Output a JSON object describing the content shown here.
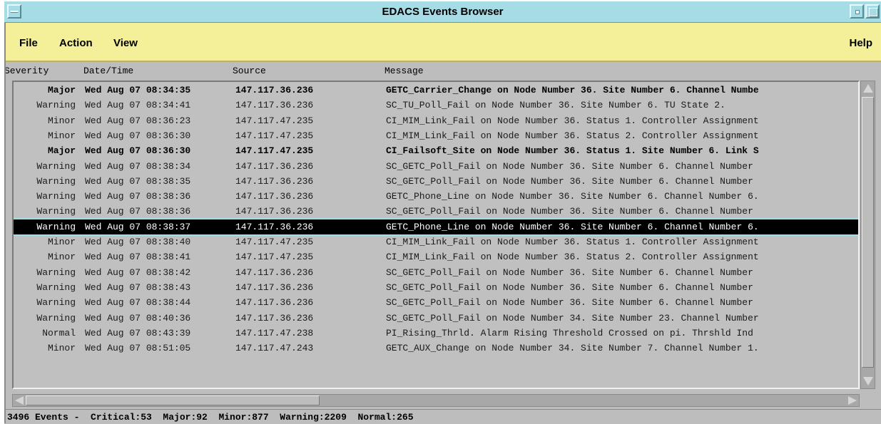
{
  "window": {
    "title": "EDACS Events Browser"
  },
  "menu": {
    "file": "File",
    "action": "Action",
    "view": "View",
    "help": "Help"
  },
  "columns": {
    "severity": "Severity",
    "datetime": "Date/Time",
    "source": "Source",
    "message": "Message"
  },
  "events": [
    {
      "severity": "Major",
      "datetime": "Wed Aug 07 08:34:35",
      "source": "147.117.36.236",
      "message": "GETC_Carrier_Change on Node Number 36. Site Number 6. Channel Numbe",
      "bold": true
    },
    {
      "severity": "Warning",
      "datetime": "Wed Aug 07 08:34:41",
      "source": "147.117.36.236",
      "message": "SC_TU_Poll_Fail on Node Number 36. Site Number 6. TU State 2."
    },
    {
      "severity": "Minor",
      "datetime": "Wed Aug 07 08:36:23",
      "source": "147.117.47.235",
      "message": "CI_MIM_Link_Fail on Node Number 36. Status 1. Controller Assignment"
    },
    {
      "severity": "Minor",
      "datetime": "Wed Aug 07 08:36:30",
      "source": "147.117.47.235",
      "message": "CI_MIM_Link_Fail on Node Number 36. Status 2. Controller Assignment"
    },
    {
      "severity": "Major",
      "datetime": "Wed Aug 07 08:36:30",
      "source": "147.117.47.235",
      "message": "CI_Failsoft_Site on Node Number 36. Status 1. Site Number 6. Link S",
      "bold": true
    },
    {
      "severity": "Warning",
      "datetime": "Wed Aug 07 08:38:34",
      "source": "147.117.36.236",
      "message": "SC_GETC_Poll_Fail on Node Number 36. Site Number 6. Channel Number"
    },
    {
      "severity": "Warning",
      "datetime": "Wed Aug 07 08:38:35",
      "source": "147.117.36.236",
      "message": "SC_GETC_Poll_Fail on Node Number 36. Site Number 6. Channel Number"
    },
    {
      "severity": "Warning",
      "datetime": "Wed Aug 07 08:38:36",
      "source": "147.117.36.236",
      "message": "GETC_Phone_Line on Node Number 36. Site Number 6. Channel Number 6."
    },
    {
      "severity": "Warning",
      "datetime": "Wed Aug 07 08:38:36",
      "source": "147.117.36.236",
      "message": "SC_GETC_Poll_Fail on Node Number 36. Site Number 6. Channel Number"
    },
    {
      "severity": "Warning",
      "datetime": "Wed Aug 07 08:38:37",
      "source": "147.117.36.236",
      "message": "GETC_Phone_Line on Node Number 36. Site Number 6. Channel Number 6.",
      "selected": true
    },
    {
      "severity": "Minor",
      "datetime": "Wed Aug 07 08:38:40",
      "source": "147.117.47.235",
      "message": "CI_MIM_Link_Fail on Node Number 36. Status 1. Controller Assignment"
    },
    {
      "severity": "Minor",
      "datetime": "Wed Aug 07 08:38:41",
      "source": "147.117.47.235",
      "message": "CI_MIM_Link_Fail on Node Number 36. Status 2. Controller Assignment"
    },
    {
      "severity": "Warning",
      "datetime": "Wed Aug 07 08:38:42",
      "source": "147.117.36.236",
      "message": "SC_GETC_Poll_Fail on Node Number 36. Site Number 6. Channel Number"
    },
    {
      "severity": "Warning",
      "datetime": "Wed Aug 07 08:38:43",
      "source": "147.117.36.236",
      "message": "SC_GETC_Poll_Fail on Node Number 36. Site Number 6. Channel Number"
    },
    {
      "severity": "Warning",
      "datetime": "Wed Aug 07 08:38:44",
      "source": "147.117.36.236",
      "message": "SC_GETC_Poll_Fail on Node Number 36. Site Number 6. Channel Number"
    },
    {
      "severity": "Warning",
      "datetime": "Wed Aug 07 08:40:36",
      "source": "147.117.36.236",
      "message": "SC_GETC_Poll_Fail on Node Number 34. Site Number 23. Channel Number"
    },
    {
      "severity": "Normal",
      "datetime": "Wed Aug 07 08:43:39",
      "source": "147.117.47.238",
      "message": "PI_Rising_Thrld.  Alarm Rising Threshold Crossed on pi. Thrshld Ind"
    },
    {
      "severity": "Minor",
      "datetime": "Wed Aug 07 08:51:05",
      "source": "147.117.47.243",
      "message": "GETC_AUX_Change on Node Number 34. Site Number 7. Channel Number 1."
    }
  ],
  "status": {
    "text": "3496 Events -  Critical:53  Major:92  Minor:877  Warning:2209  Normal:265"
  },
  "icons": {
    "window_menu": "window-menu-icon",
    "minimize": "minimize-icon",
    "maximize": "maximize-icon"
  },
  "colors": {
    "titlebar": "#a6dce6",
    "menubar": "#f4f09a",
    "list_bg": "#c0c0c0",
    "selected_bg": "#000000"
  }
}
